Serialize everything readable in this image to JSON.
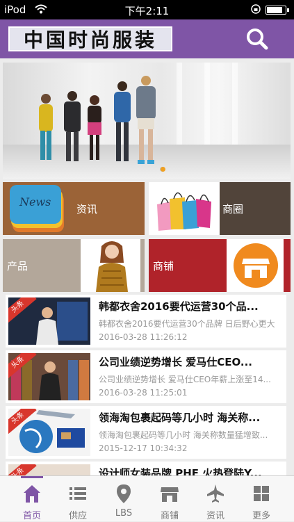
{
  "status_bar": {
    "carrier": "iPod",
    "time": "下午2:11"
  },
  "header": {
    "logo_text": "中国时尚服装",
    "search_icon": "search-icon",
    "bar_color": "#7f55a6"
  },
  "banner": {
    "image": "fashion-group-photo",
    "active_dot": 1,
    "dot_count": 2
  },
  "tiles": [
    {
      "label": "资讯",
      "icon": "news-icon",
      "color": "#9b6337"
    },
    {
      "label": "商圈",
      "icon": "shopping-bags-icon",
      "color": "#51443a"
    },
    {
      "label": "产品",
      "icon": "model-photo",
      "color": "#b3a79a"
    },
    {
      "label": "商铺",
      "icon": "store-icon",
      "color": "#b0232a"
    }
  ],
  "news": {
    "badge": "头条",
    "items": [
      {
        "title": "韩都衣舍2016要代运营30个品...",
        "summary": "韩都衣舍2016要代运营30个品牌 日后野心更大",
        "date": "2016-03-28 11:26:12"
      },
      {
        "title": "公司业绩逆势增长 爱马仕CEO...",
        "summary": "公司业绩逆势增长 爱马仕CEO年薪上涨至14...",
        "date": "2016-03-28 11:25:01"
      },
      {
        "title": "领海淘包裹起码等几小时 海关称...",
        "summary": "领海淘包裹起码等几小时 海关称数量猛增致...",
        "date": "2015-12-17 10:34:32"
      },
      {
        "title": "设计师女装品牌 PHE 火热登陆Y..."
      }
    ]
  },
  "tabs": [
    {
      "label": "首页",
      "icon": "home-icon",
      "active": true
    },
    {
      "label": "供应",
      "icon": "list-icon",
      "active": false
    },
    {
      "label": "LBS",
      "icon": "location-pin-icon",
      "active": false
    },
    {
      "label": "商铺",
      "icon": "store-icon",
      "active": false
    },
    {
      "label": "资讯",
      "icon": "airplane-icon",
      "active": false
    },
    {
      "label": "更多",
      "icon": "grid-icon",
      "active": false
    }
  ]
}
